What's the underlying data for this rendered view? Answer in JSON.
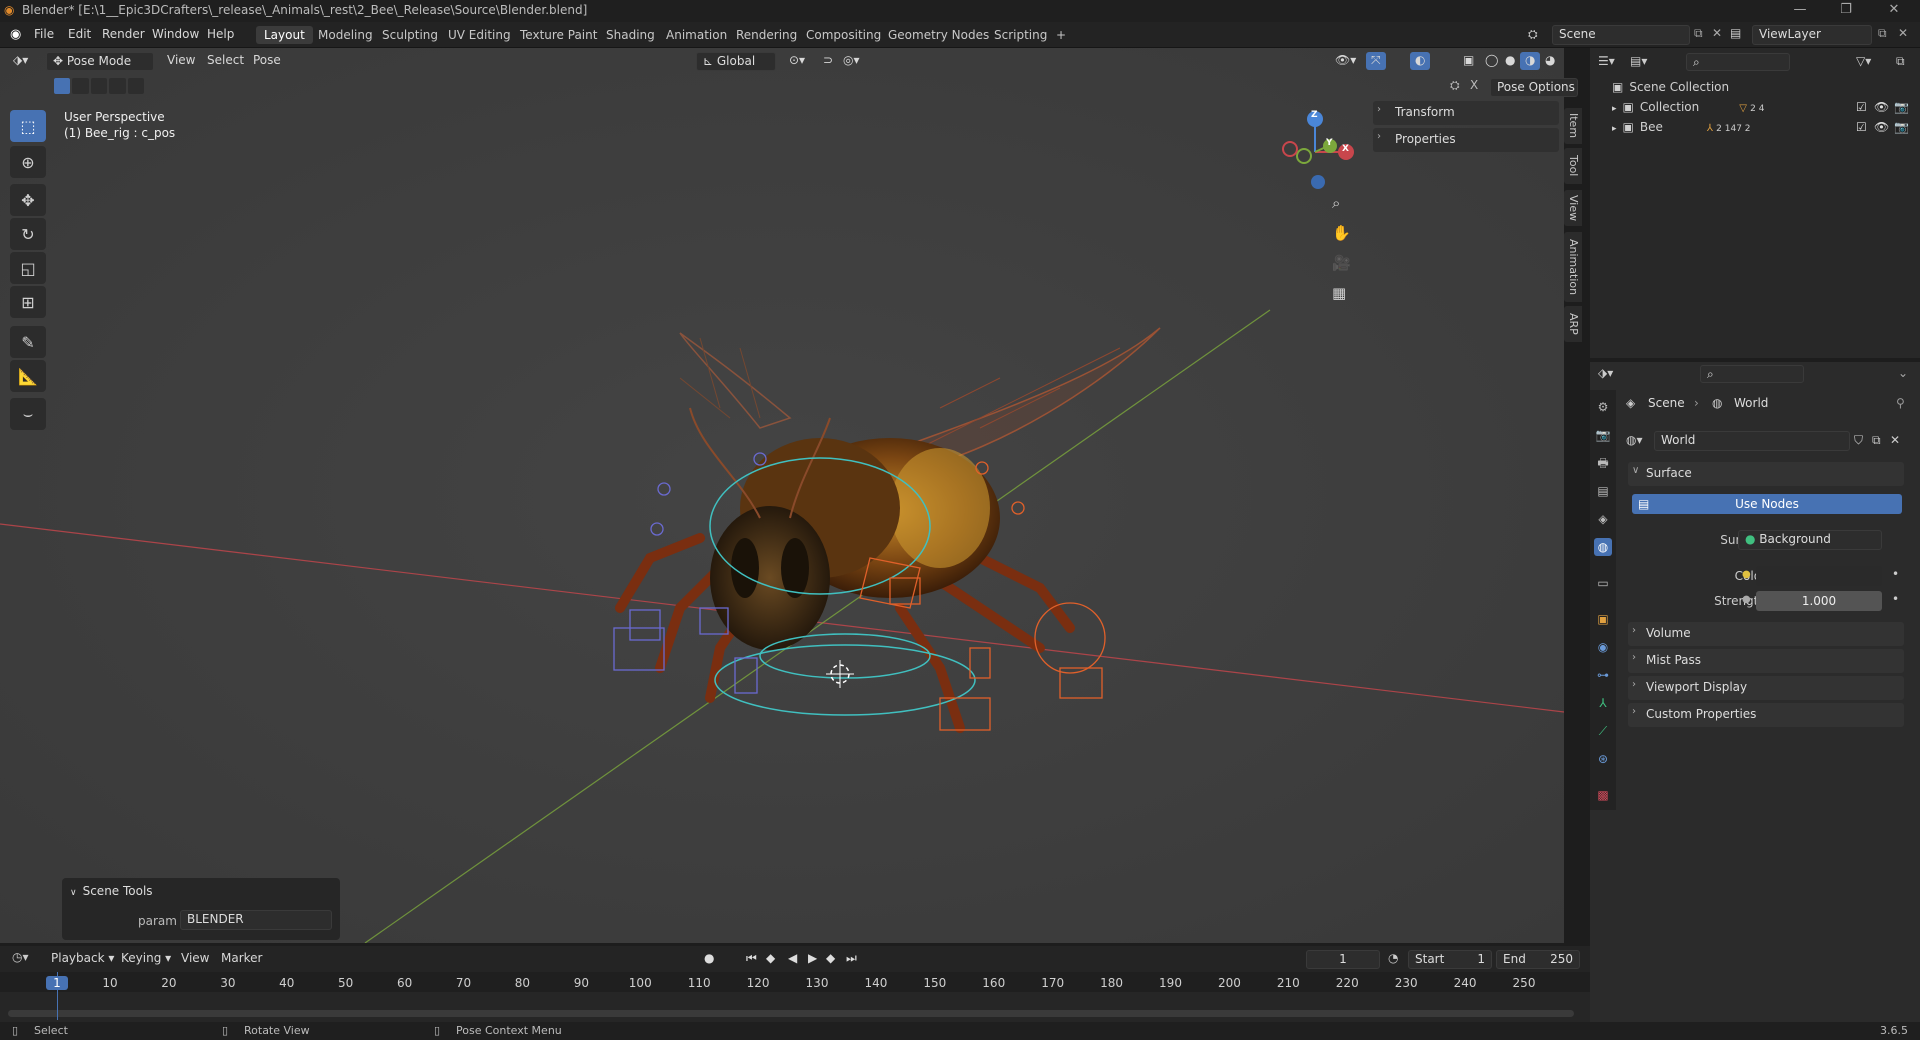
{
  "titlebar": {
    "title": "Blender* [E:\\1__Epic3DCrafters\\_release\\_Animals\\_rest\\2_Bee\\_Release\\Source\\Blender.blend]",
    "minimize": "—",
    "maximize": "❐",
    "close": "✕"
  },
  "menu": [
    "File",
    "Edit",
    "Render",
    "Window",
    "Help"
  ],
  "workspaces": [
    "Layout",
    "Modeling",
    "Sculpting",
    "UV Editing",
    "Texture Paint",
    "Shading",
    "Animation",
    "Rendering",
    "Compositing",
    "Geometry Nodes",
    "Scripting",
    "+"
  ],
  "scene_field": "Scene",
  "viewlayer_field": "ViewLayer",
  "viewport_header": {
    "mode": "Pose Mode",
    "view": "View",
    "select": "Select",
    "pose": "Pose",
    "orientation": "Global",
    "pose_options": "Pose Options"
  },
  "viewport_info": {
    "line1": "User Perspective",
    "line2": "(1) Bee_rig : c_pos"
  },
  "gizmo": {
    "z": "Z",
    "y": "Y",
    "x": "X"
  },
  "sidebar_tabs": [
    "Item",
    "Tool",
    "View",
    "Animation",
    "ARP"
  ],
  "npanel": {
    "transform": "Transform",
    "properties": "Properties"
  },
  "scene_tools": {
    "header": "Scene Tools",
    "param_label": "param",
    "param_value": "BLENDER"
  },
  "outliner": {
    "root": "Scene Collection",
    "rows": [
      {
        "name": "Collection",
        "counts": "2  4"
      },
      {
        "name": "Bee",
        "counts": "2  147  2"
      }
    ]
  },
  "properties": {
    "breadcrumb": {
      "scene": "Scene",
      "world": "World"
    },
    "world_field": "World",
    "surface_section": "Surface",
    "use_nodes": "Use Nodes",
    "surface_label": "Surface",
    "surface_value": "Background",
    "color_label": "Color",
    "strength_label": "Strength",
    "strength_value": "1.000",
    "sections": [
      "Volume",
      "Mist Pass",
      "Viewport Display",
      "Custom Properties"
    ]
  },
  "timeline": {
    "playback": "Playback",
    "keying": "Keying",
    "view": "View",
    "marker": "Marker",
    "current_frame": "1",
    "start_label": "Start",
    "start_value": "1",
    "end_label": "End",
    "end_value": "250",
    "ticks": [
      "1",
      "10",
      "20",
      "30",
      "40",
      "50",
      "60",
      "70",
      "80",
      "90",
      "100",
      "110",
      "120",
      "130",
      "140",
      "150",
      "160",
      "170",
      "180",
      "190",
      "200",
      "210",
      "220",
      "230",
      "240",
      "250"
    ]
  },
  "statusbar": {
    "select": "Select",
    "rotate": "Rotate View",
    "context": "Pose Context Menu",
    "version": "3.6.5"
  },
  "colors": {
    "accent": "#4772b3",
    "x_axis": "#c8464c",
    "y_axis": "#7ca83c",
    "bone_orange": "#e0602a",
    "bone_blue": "#6a6ad0",
    "bone_cyan": "#40c0c0"
  }
}
